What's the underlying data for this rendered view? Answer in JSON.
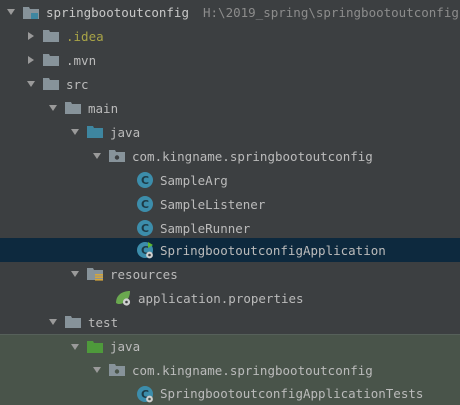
{
  "project": {
    "name": "springbootoutconfig",
    "path": "H:\\2019_spring\\springbootoutconfig"
  },
  "nodes": {
    "idea": ".idea",
    "mvn": ".mvn",
    "src": "src",
    "main": "main",
    "main_java": "java",
    "main_package": "com.kingname.springbootoutconfig",
    "class_sample_arg": "SampleArg",
    "class_sample_listener": "SampleListener",
    "class_sample_runner": "SampleRunner",
    "class_application": "SpringbootoutconfigApplication",
    "resources": "resources",
    "properties_file": "application.properties",
    "test": "test",
    "test_java": "java",
    "test_package": "com.kingname.springbootoutconfig",
    "class_application_tests": "SpringbootoutconfigApplicationTests"
  },
  "colors": {
    "panel_background": "#3c3f41",
    "selection": "#0d293e",
    "test_highlight": "#49544a",
    "folder": "#87939a",
    "source_folder": "#3e86a0",
    "test_folder": "#4e9a3b",
    "class_icon": "#3c8dab",
    "excluded_text": "#a9a447"
  }
}
